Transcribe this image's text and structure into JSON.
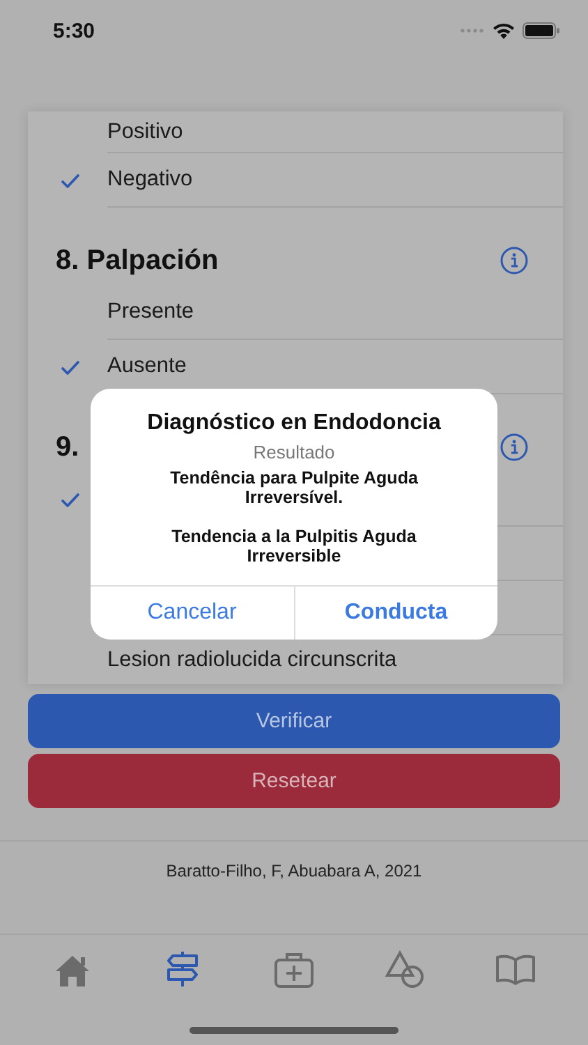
{
  "status_bar": {
    "time": "5:30"
  },
  "sections": [
    {
      "options": [
        {
          "label": "Positivo",
          "checked": false
        },
        {
          "label": "Negativo",
          "checked": true
        }
      ]
    },
    {
      "title": "8. Palpación",
      "options": [
        {
          "label": "Presente",
          "checked": false
        },
        {
          "label": "Ausente",
          "checked": true
        }
      ]
    },
    {
      "title": "9.",
      "options": [
        {
          "checked": true
        },
        {
          "checked": false
        },
        {
          "checked": false
        },
        {
          "label": "Lesion radiolucida circunscrita",
          "checked": false
        }
      ]
    }
  ],
  "buttons": [
    {
      "label": "Verificar",
      "kind": "primary"
    },
    {
      "label": "Resetear",
      "kind": "destructive"
    }
  ],
  "footer": "Baratto-Filho, F, Abuabara A, 2021",
  "tabs": [
    {
      "selected": false
    },
    {
      "selected": true
    },
    {
      "selected": false
    },
    {
      "selected": false
    },
    {
      "selected": false
    }
  ],
  "alert": {
    "title": "Diagnóstico en Endodoncia",
    "subtitle": "Resultado",
    "messages": [
      "Tendência para Pulpite Aguda Irreversível.",
      "Tendencia a la Pulpitis Aguda Irreversible"
    ],
    "actions": [
      {
        "label": "Cancelar",
        "kind": "cancel"
      },
      {
        "label": "Conducta",
        "kind": "default"
      }
    ]
  }
}
